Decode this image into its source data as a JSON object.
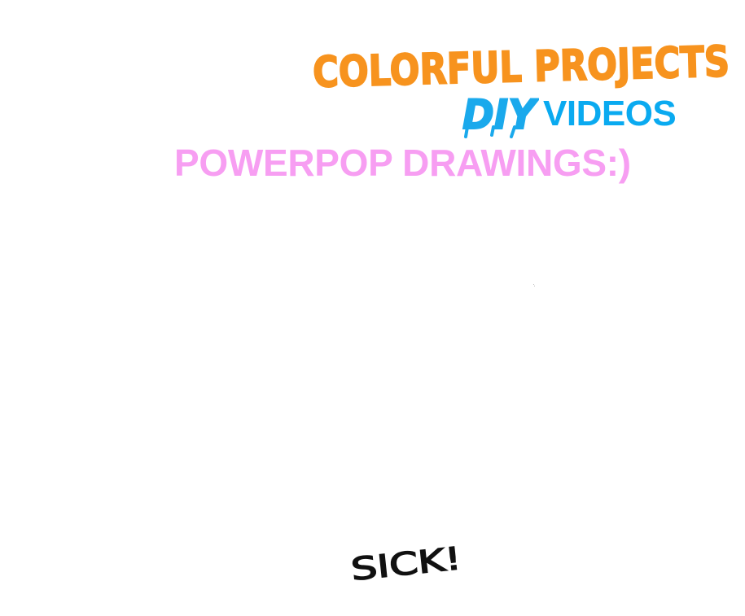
{
  "header": {
    "title_line1": "COLORFUL PROJECTS",
    "title_line1_color": "#f7931e",
    "diy_logo_text": "DIY",
    "diy_color": "#1aa9ec",
    "videos_label": "VIDEOS",
    "videos_color": "#0aaaf0"
  },
  "subtitle": {
    "text": "POWERPOP DRAWINGS:)",
    "color": "#f79ef2"
  },
  "footer": {
    "sick_text": "SICK!",
    "sick_color": "#111111"
  },
  "background_color": "#ffffff"
}
